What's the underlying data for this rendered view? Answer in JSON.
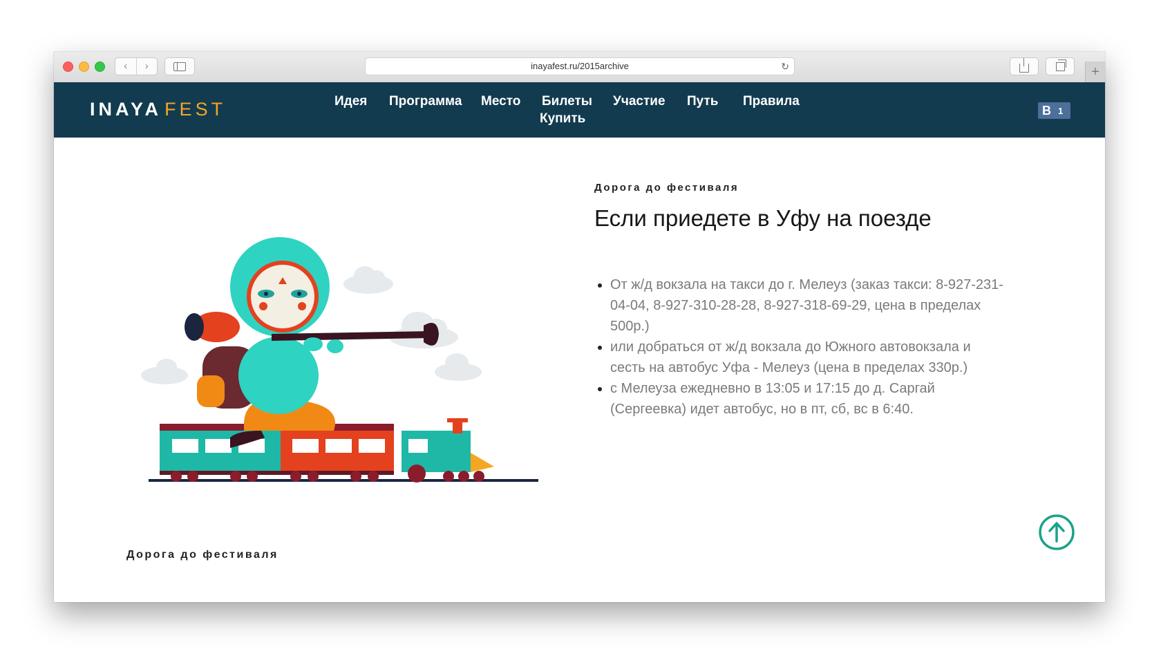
{
  "browser": {
    "url": "inayafest.ru/2015archive",
    "back_glyph": "‹",
    "forward_glyph": "›",
    "reload_glyph": "↻",
    "newtab_glyph": "+"
  },
  "site": {
    "logo_main": "INAYA",
    "logo_accent": "FEST",
    "nav": [
      "Идея",
      "Программа",
      "Место",
      "Билеты",
      "Купить",
      "Участие",
      "Путь",
      "Правила"
    ],
    "vk": {
      "letter": "B",
      "count": "1"
    },
    "colors": {
      "header_bg": "#123b4f",
      "accent": "#f5a623",
      "teal": "#1aa38a"
    }
  },
  "content": {
    "eyebrow": "Дорога до фестиваля",
    "heading": "Если приедете в Уфу на поезде",
    "items": [
      "От ж/д вокзала на такси до г. Мелеуз (заказ такси: 8-927-231-04-04, 8-927-310-28-28, 8-927-318-69-29, цена в пределах 500р.)",
      "или добраться от ж/д вокзала до Южного автовокзала и сесть на автобус Уфа - Мелеуз (цена в пределах 330р.)",
      "с Мелеуза ежедневно в 13:05 и 17:15 до д. Саргай (Сергеевка) идет автобус, но в пт, сб, вс в 6:40."
    ],
    "eyebrow_bottom": "Дорога до фестиваля"
  },
  "icons": {
    "scroll_top": "arrow-up-circle-icon",
    "illustration": "traveler-on-train-illustration"
  }
}
